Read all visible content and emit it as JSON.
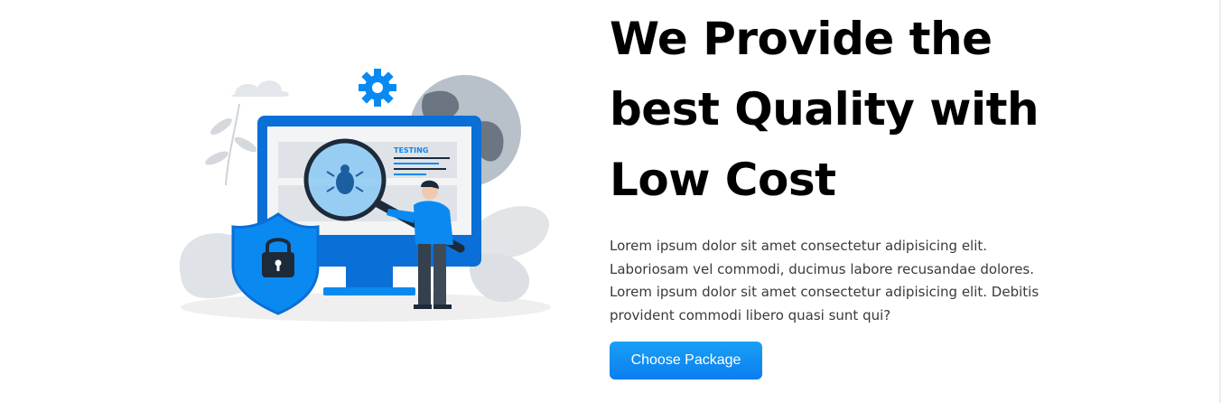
{
  "hero": {
    "headline_lines": [
      "We Provide the",
      "best Quality with",
      "Low Cost"
    ],
    "description_lines": [
      "Lorem ipsum dolor sit amet consectetur adipisicing elit.",
      "Laboriosam vel commodi, ducimus labore recusandae dolores.",
      "Lorem ipsum dolor sit amet consectetur adipisicing elit. Debitis",
      "provident commodi libero quasi sunt qui?"
    ],
    "cta_label": "Choose Package"
  },
  "illustration": {
    "screen_label": "TESTING",
    "colors": {
      "accent": "#0a8af0",
      "dark": "#1c2a3a",
      "grey": "#6b7682"
    }
  }
}
